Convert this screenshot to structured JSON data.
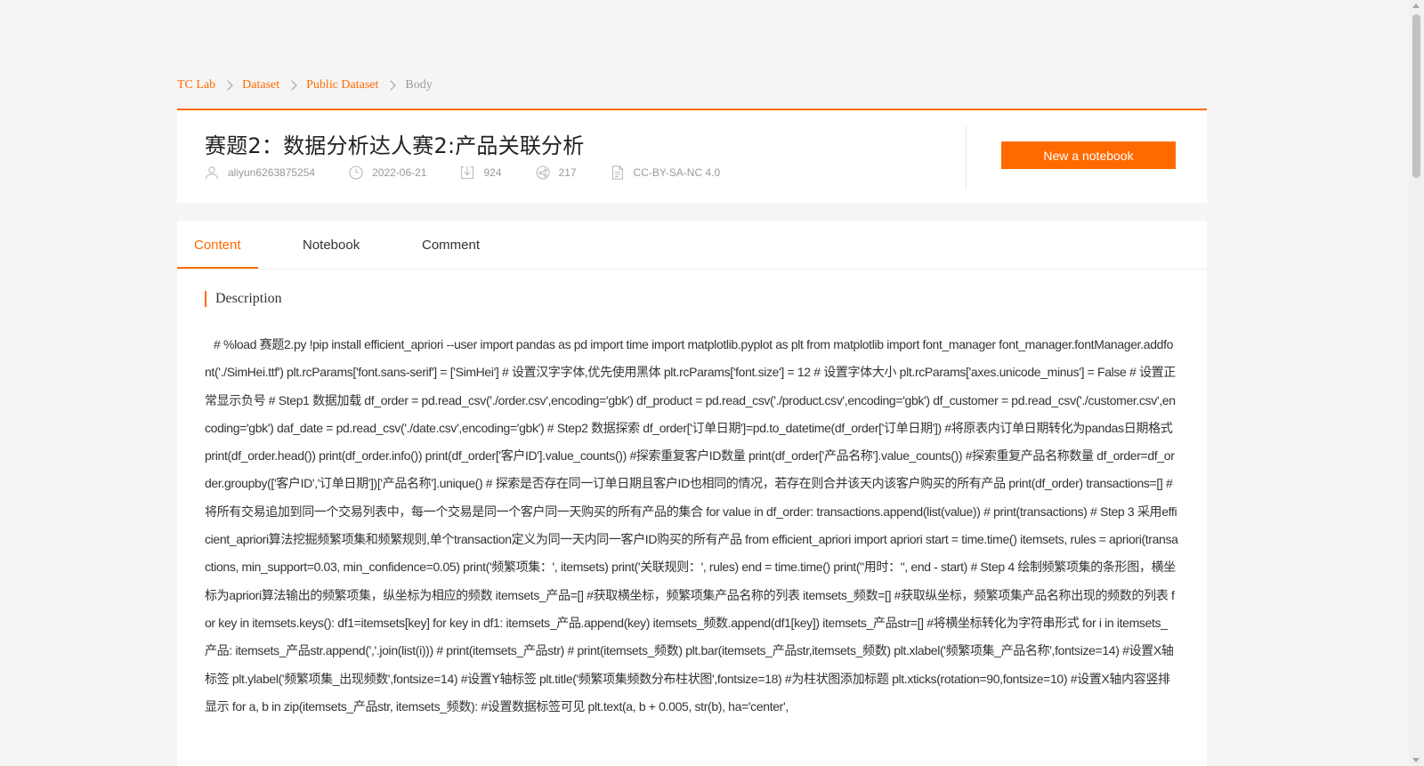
{
  "breadcrumb": {
    "items": [
      "TC Lab",
      "Dataset",
      "Public Dataset"
    ],
    "current": "Body"
  },
  "dataset": {
    "title": "赛题2：数据分析达人赛2:产品关联分析",
    "author": "aliyun6263875254",
    "date": "2022-06-21",
    "downloads": "924",
    "shares": "217",
    "license": "CC-BY-SA-NC 4.0",
    "new_notebook_label": "New a notebook"
  },
  "icons": {
    "author": "user-icon",
    "date": "clock-icon",
    "downloads": "download-icon",
    "shares": "share-icon",
    "license": "document-icon"
  },
  "colors": {
    "accent": "#ff6a00",
    "muted": "#999999"
  },
  "tabs": [
    {
      "label": "Content",
      "active": true
    },
    {
      "label": "Notebook",
      "active": false
    },
    {
      "label": "Comment",
      "active": false
    }
  ],
  "description": {
    "title": "Description",
    "text": "# %load 赛题2.py !pip install efficient_apriori --user import pandas as pd import time import matplotlib.pyplot as plt from matplotlib import font_manager font_manager.fontManager.addfont('./SimHei.ttf') plt.rcParams['font.sans-serif'] = ['SimHei'] # 设置汉字字体,优先使用黑体 plt.rcParams['font.size'] = 12 # 设置字体大小 plt.rcParams['axes.unicode_minus'] = False # 设置正常显示负号 # Step1 数据加载 df_order = pd.read_csv('./order.csv',encoding='gbk') df_product = pd.read_csv('./product.csv',encoding='gbk') df_customer = pd.read_csv('./customer.csv',encoding='gbk') daf_date = pd.read_csv('./date.csv',encoding='gbk') # Step2 数据探索 df_order['订单日期']=pd.to_datetime(df_order['订单日期']) #将原表内订单日期转化为pandas日期格式 print(df_order.head()) print(df_order.info()) print(df_order['客户ID'].value_counts()) #探索重复客户ID数量 print(df_order['产品名称'].value_counts()) #探索重复产品名称数量 df_order=df_order.groupby(['客户ID','订单日期'])['产品名称'].unique() # 探索是否存在同一订单日期且客户ID也相同的情况，若存在则合并该天内该客户购买的所有产品 print(df_order) transactions=[] #将所有交易追加到同一个交易列表中，每一个交易是同一个客户同一天购买的所有产品的集合 for value in df_order: transactions.append(list(value)) # print(transactions) # Step 3 采用efficient_apriori算法挖掘频繁项集和频繁规则,单个transaction定义为同一天内同一客户ID购买的所有产品 from efficient_apriori import apriori start = time.time() itemsets, rules = apriori(transactions, min_support=0.03, min_confidence=0.05) print('频繁项集：', itemsets) print('关联规则：', rules) end = time.time() print(\"用时：\", end - start) # Step 4 绘制频繁项集的条形图，横坐标为apriori算法输出的频繁项集，纵坐标为相应的频数 itemsets_产品=[] #获取横坐标，频繁项集产品名称的列表 itemsets_频数=[] #获取纵坐标，频繁项集产品名称出现的频数的列表 for key in itemsets.keys(): df1=itemsets[key] for key in df1: itemsets_产品.append(key) itemsets_频数.append(df1[key]) itemsets_产品str=[] #将横坐标转化为字符串形式 for i in itemsets_产品: itemsets_产品str.append(','.join(list(i))) # print(itemsets_产品str) # print(itemsets_频数) plt.bar(itemsets_产品str,itemsets_频数) plt.xlabel('频繁项集_产品名称',fontsize=14) #设置X轴标签 plt.ylabel('频繁项集_出现频数',fontsize=14) #设置Y轴标签 plt.title('频繁项集频数分布柱状图',fontsize=18) #为柱状图添加标题 plt.xticks(rotation=90,fontsize=10) #设置X轴内容竖排显示 for a, b in zip(itemsets_产品str, itemsets_频数): #设置数据标签可见 plt.text(a, b + 0.005, str(b), ha='center',"
  }
}
